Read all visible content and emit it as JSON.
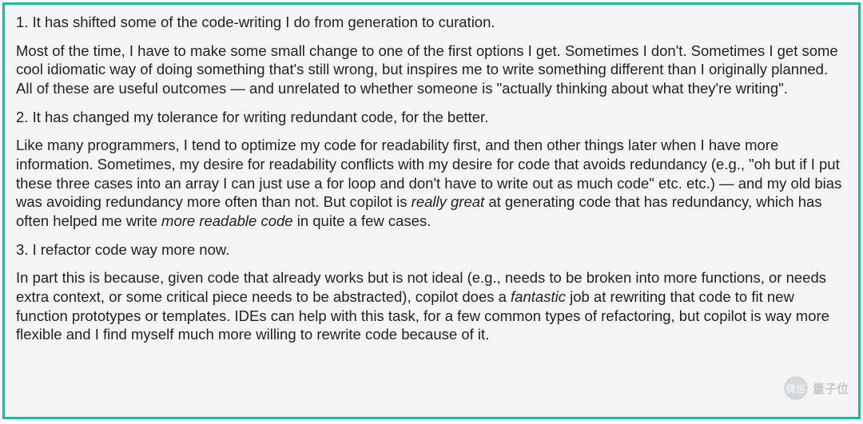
{
  "sections": [
    {
      "number": "1.",
      "heading": "It has shifted some of the code-writing I do from generation to curation.",
      "body_pre": "Most of the time, I have to make some small change to one of the first options I get. Sometimes I don't. Sometimes I get some cool idiomatic way of doing something that's still wrong, but inspires me to write something different than I originally planned. All of these are useful outcomes — and unrelated to whether someone is \"actually thinking about what they're writing\".",
      "em1": "",
      "mid1": "",
      "em2": "",
      "body_post": ""
    },
    {
      "number": "2.",
      "heading": "It has changed my tolerance for writing redundant code, for the better.",
      "body_pre": "Like many programmers, I tend to optimize my code for readability first, and then other things later when I have more information. Sometimes, my desire for readability conflicts with my desire for code that avoids redundancy (e.g., \"oh but if I put these three cases into an array I can just use a for loop and don't have to write out as much code\" etc. etc.) — and my old bias was avoiding redundancy more often than not. But copilot is ",
      "em1": "really great",
      "mid1": " at generating code that has redundancy, which has often helped me write ",
      "em2": "more readable code",
      "body_post": " in quite a few cases."
    },
    {
      "number": "3.",
      "heading": "I refactor code way more now.",
      "body_pre": "In part this is because, given code that already works but is not ideal (e.g., needs to be broken into more functions, or needs extra context, or some critical piece needs to be abstracted), copilot does a ",
      "em1": "fantastic",
      "mid1": " job at rewriting that code to fit new function prototypes or templates. IDEs can help with this task, for a few common types of refactoring, but copilot is way more flexible and I find myself much more willing to rewrite code because of it.",
      "em2": "",
      "body_post": ""
    }
  ],
  "watermark": {
    "icon_label": "微信",
    "text": "量子位"
  }
}
